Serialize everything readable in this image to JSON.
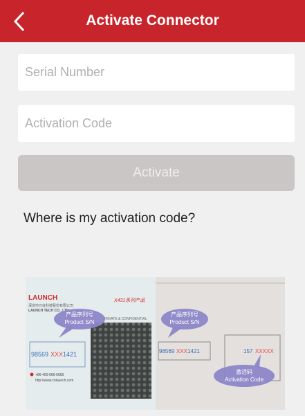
{
  "header": {
    "title": "Activate Connector"
  },
  "form": {
    "serial_placeholder": "Serial Number",
    "code_placeholder": "Activation Code",
    "activate_label": "Activate"
  },
  "help": {
    "question": "Where is my activation code?"
  },
  "image": {
    "left_panel": {
      "brand": "LAUNCH",
      "company_cn": "深圳市元征科技股份有限公司",
      "company_en": "LAUNCH TECH CO., LTD.",
      "series": "X431系列产品",
      "sn_label_cn": "产品序列号",
      "product_sn_label": "Product S/N",
      "confidential": "PRIVATE & CONFIDENTIAL",
      "serial_prefix": "98569",
      "serial_mask": "XXX",
      "serial_suffix": "1421",
      "phone": "+86-400-066-6666",
      "website": "http://www.cnlaunch.com"
    },
    "right_panel": {
      "sn_label_cn": "产品序列号",
      "product_sn_label": "Product S/N",
      "serial_prefix": "98569",
      "serial_mask": "XXX",
      "serial_suffix": "1421",
      "code_prefix": "157",
      "code_mask": "XXXXX",
      "code_label_cn": "激活码",
      "activation_code_label": "Activation Code"
    }
  }
}
